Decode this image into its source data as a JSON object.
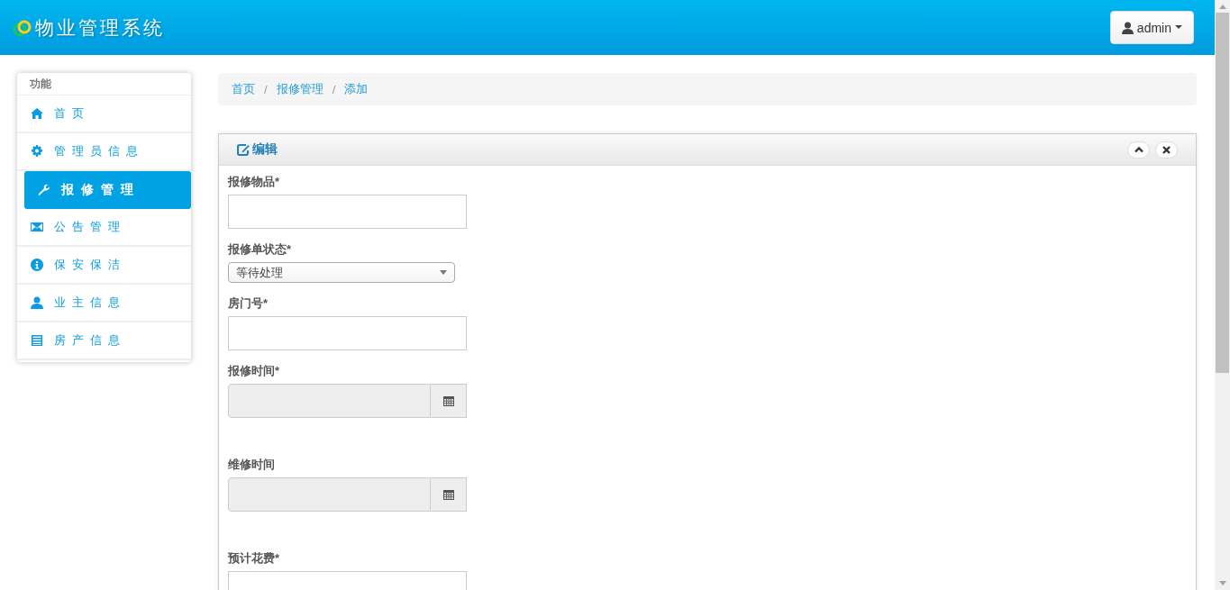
{
  "header": {
    "title": "物业管理系统",
    "user": "admin"
  },
  "sidebar": {
    "title": "功能",
    "items": [
      {
        "label": "首页",
        "selected": false
      },
      {
        "label": "管理员信息",
        "selected": false
      },
      {
        "label": "报修管理",
        "selected": true
      },
      {
        "label": "公告管理",
        "selected": false
      },
      {
        "label": "保安保洁",
        "selected": false
      },
      {
        "label": "业主信息",
        "selected": false
      },
      {
        "label": "房产信息",
        "selected": false
      }
    ]
  },
  "breadcrumb": {
    "separator": "/",
    "items": [
      "首页",
      "报修管理",
      "添加"
    ]
  },
  "panel": {
    "title": "编辑",
    "fields": [
      {
        "kind": "text",
        "label": "报修物品*"
      },
      {
        "kind": "select",
        "label": "报修单状态*",
        "value": "等待处理"
      },
      {
        "kind": "text",
        "label": "房门号*"
      },
      {
        "kind": "date",
        "label": "报修时间*"
      },
      {
        "kind": "date",
        "label": "维修时间"
      },
      {
        "kind": "text",
        "label": "预计花费*"
      }
    ]
  }
}
